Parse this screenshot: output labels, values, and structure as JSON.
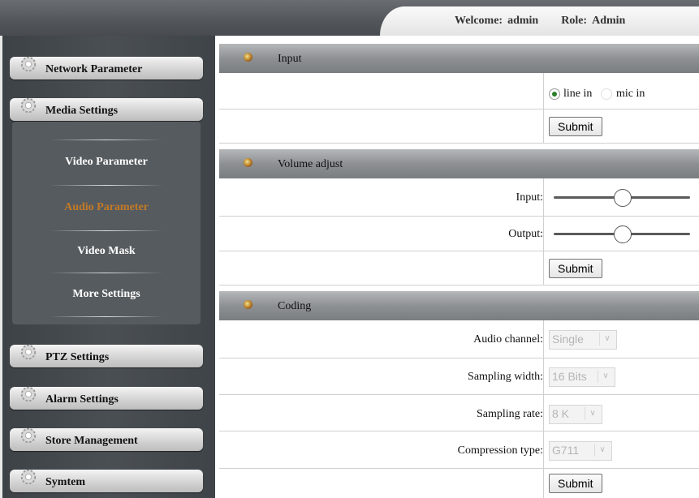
{
  "header": {
    "welcome_label": "Welcome:",
    "user": "admin",
    "role_label": "Role:",
    "role": "Admin"
  },
  "sidebar": {
    "menu": [
      {
        "label": "Network Parameter"
      },
      {
        "label": "Media Settings"
      },
      {
        "label": "PTZ Settings"
      },
      {
        "label": "Alarm Settings"
      },
      {
        "label": "Store Management"
      },
      {
        "label": "Symtem"
      }
    ],
    "submenu": [
      {
        "label": "Video Parameter"
      },
      {
        "label": "Audio Parameter"
      },
      {
        "label": "Video Mask"
      },
      {
        "label": "More Settings"
      }
    ],
    "active_color": "#c27a27"
  },
  "input_section": {
    "title": "Input",
    "options": [
      {
        "label": "line in",
        "checked": true
      },
      {
        "label": "mic in",
        "checked": false
      }
    ],
    "submit": "Submit"
  },
  "volume_section": {
    "title": "Volume adjust",
    "input_label": "Input:",
    "input_level": 0.5,
    "output_label": "Output:",
    "output_level": 0.5,
    "submit": "Submit"
  },
  "coding_section": {
    "title": "Coding",
    "audio_channel_label": "Audio channel:",
    "audio_channel_value": "Single",
    "sampling_width_label": "Sampling width:",
    "sampling_width_value": "16 Bits",
    "sampling_rate_label": "Sampling rate:",
    "sampling_rate_value": "8 K",
    "compression_label": "Compression type:",
    "compression_value": "G711",
    "submit": "Submit"
  }
}
